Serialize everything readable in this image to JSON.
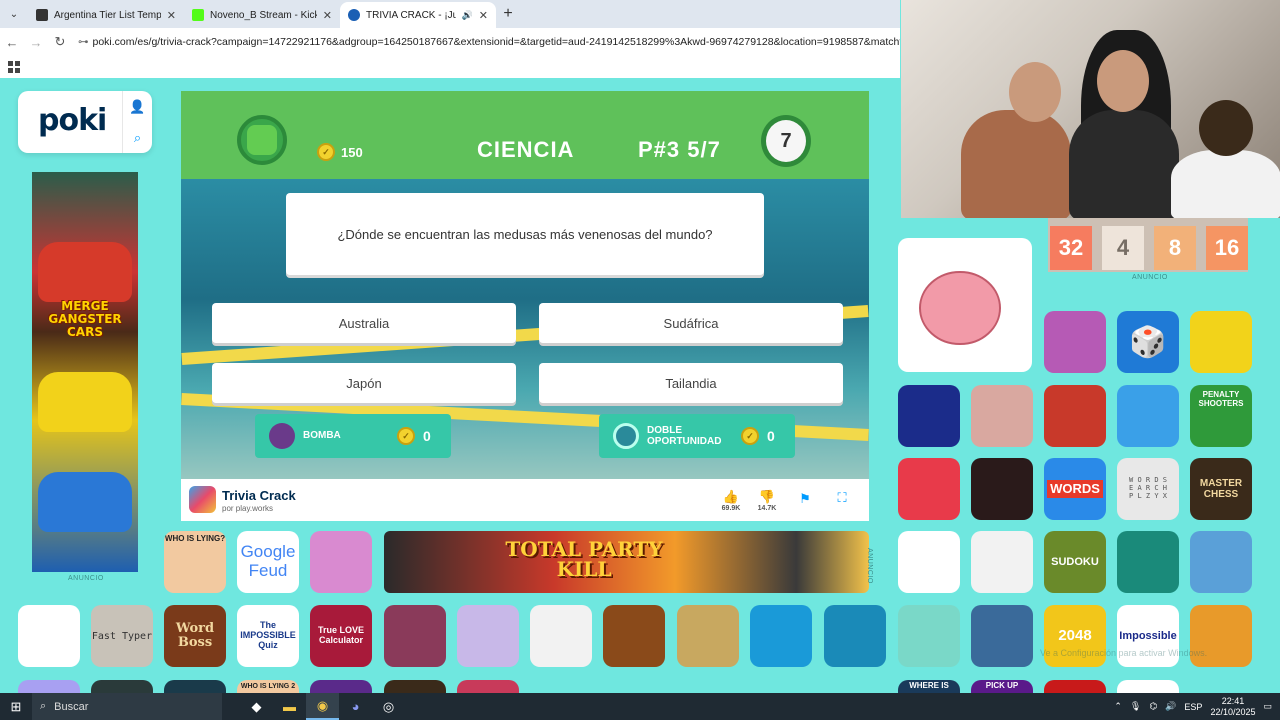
{
  "browser": {
    "tabs": [
      {
        "title": "Argentina Tier List Templates - ",
        "favicon_color": "#333333",
        "active": false
      },
      {
        "title": "Noveno_B Stream - Kick Dashbo",
        "favicon_color": "#53fc18",
        "active": false
      },
      {
        "title": "TRIVIA CRACK - ¡Juega Gratis!",
        "favicon_color": "#1a5fb4",
        "active": true
      }
    ],
    "url": "poki.com/es/g/trivia-crack?campaign=14722921176&adgroup=164250187667&extensionid=&targetid=aud-2419142518299%3Akwd-96974279128&location=9198587&matchtype=e&network"
  },
  "poki": {
    "logo": "poki",
    "left_ad_text": "MERGE GANGSTER CARS",
    "ad_label": "ANUNCIO"
  },
  "game": {
    "coins": "150",
    "category": "CIENCIA",
    "progress": "P#3  5/7",
    "timer": "7",
    "question": "¿Dónde se encuentran las medusas más venenosas del mundo?",
    "answers": [
      "Australia",
      "Sudáfrica",
      "Japón",
      "Tailandia"
    ],
    "powerups": [
      {
        "label": "BOMBA",
        "count": "0"
      },
      {
        "label": "DOBLE OPORTUNIDAD",
        "count": "0"
      }
    ],
    "title": "Trivia Crack",
    "developer": "por play.works",
    "likes": "69.9K",
    "dislikes": "14.7K"
  },
  "tiles": {
    "who_is_lying": "WHO IS LYING?",
    "google_feud": "Google Feud",
    "banner": "TOTAL PARTY KILL",
    "fast_typer": "Fast Typer",
    "word_boss": "Word Boss",
    "impossible_quiz": "The IMPOSSIBLE Quiz",
    "love_calculator": "True LOVE Calculator",
    "words": "WORDS",
    "master_chess": "MASTER CHESS",
    "sudoku": "SUDOKU",
    "g2048": "2048",
    "impossible": "Impossible",
    "penalty": "PENALTY SHOOTERS",
    "where_is": "WHERE IS",
    "pick_up": "PICK UP",
    "who_is_lying_2": "WHO IS LYING 2"
  },
  "game2048": [
    "32",
    "4",
    "8",
    "16"
  ],
  "taskbar": {
    "search": "Buscar",
    "lang": "ESP",
    "time": "22:41",
    "date": "22/10/2025"
  },
  "watermark": "Ve a Configuración para activar Windows."
}
